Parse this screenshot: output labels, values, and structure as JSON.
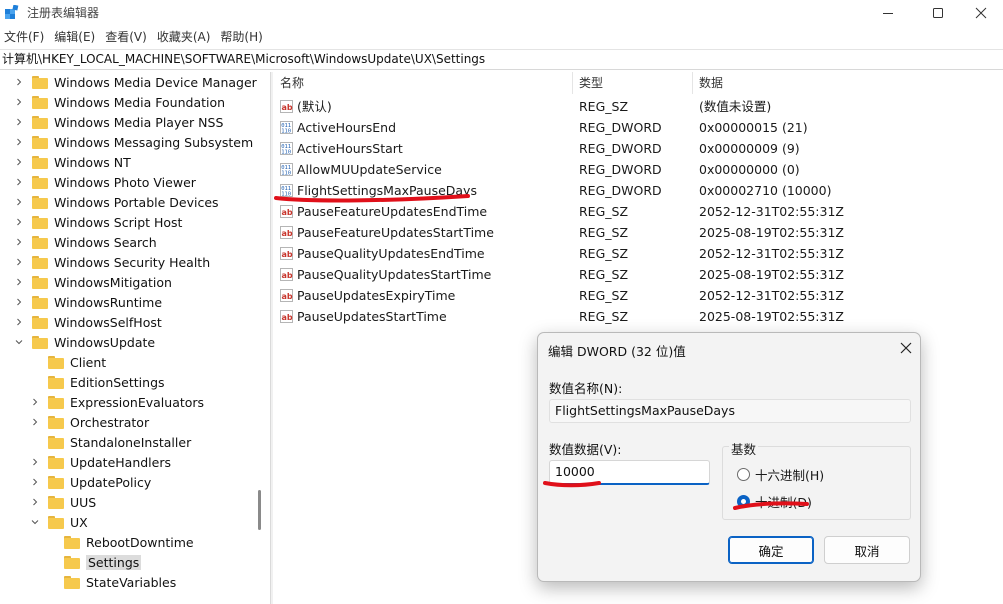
{
  "window": {
    "title": "注册表编辑器"
  },
  "menu": [
    "文件(F)",
    "编辑(E)",
    "查看(V)",
    "收藏夹(A)",
    "帮助(H)"
  ],
  "address": "计算机\\HKEY_LOCAL_MACHINE\\SOFTWARE\\Microsoft\\WindowsUpdate\\UX\\Settings",
  "tree": [
    {
      "label": "Windows Media Device Manager",
      "level": 0,
      "expander": "collapsed"
    },
    {
      "label": "Windows Media Foundation",
      "level": 0,
      "expander": "collapsed"
    },
    {
      "label": "Windows Media Player NSS",
      "level": 0,
      "expander": "collapsed"
    },
    {
      "label": "Windows Messaging Subsystem",
      "level": 0,
      "expander": "collapsed"
    },
    {
      "label": "Windows NT",
      "level": 0,
      "expander": "collapsed"
    },
    {
      "label": "Windows Photo Viewer",
      "level": 0,
      "expander": "collapsed"
    },
    {
      "label": "Windows Portable Devices",
      "level": 0,
      "expander": "collapsed"
    },
    {
      "label": "Windows Script Host",
      "level": 0,
      "expander": "collapsed"
    },
    {
      "label": "Windows Search",
      "level": 0,
      "expander": "collapsed"
    },
    {
      "label": "Windows Security Health",
      "level": 0,
      "expander": "collapsed"
    },
    {
      "label": "WindowsMitigation",
      "level": 0,
      "expander": "collapsed"
    },
    {
      "label": "WindowsRuntime",
      "level": 0,
      "expander": "collapsed"
    },
    {
      "label": "WindowsSelfHost",
      "level": 0,
      "expander": "collapsed"
    },
    {
      "label": "WindowsUpdate",
      "level": 0,
      "expander": "expanded"
    },
    {
      "label": "Client",
      "level": 1,
      "expander": "none"
    },
    {
      "label": "EditionSettings",
      "level": 1,
      "expander": "none"
    },
    {
      "label": "ExpressionEvaluators",
      "level": 1,
      "expander": "collapsed"
    },
    {
      "label": "Orchestrator",
      "level": 1,
      "expander": "collapsed"
    },
    {
      "label": "StandaloneInstaller",
      "level": 1,
      "expander": "none"
    },
    {
      "label": "UpdateHandlers",
      "level": 1,
      "expander": "collapsed"
    },
    {
      "label": "UpdatePolicy",
      "level": 1,
      "expander": "collapsed"
    },
    {
      "label": "UUS",
      "level": 1,
      "expander": "collapsed"
    },
    {
      "label": "UX",
      "level": 1,
      "expander": "expanded"
    },
    {
      "label": "RebootDowntime",
      "level": 2,
      "expander": "none"
    },
    {
      "label": "Settings",
      "level": 2,
      "expander": "none",
      "selected": true
    },
    {
      "label": "StateVariables",
      "level": 2,
      "expander": "none"
    }
  ],
  "list": {
    "columns": [
      "名称",
      "类型",
      "数据"
    ],
    "rows": [
      {
        "icon": "string-value-icon",
        "name": "(默认)",
        "type": "REG_SZ",
        "data": "(数值未设置)"
      },
      {
        "icon": "binary-value-icon",
        "name": "ActiveHoursEnd",
        "type": "REG_DWORD",
        "data": "0x00000015 (21)"
      },
      {
        "icon": "binary-value-icon",
        "name": "ActiveHoursStart",
        "type": "REG_DWORD",
        "data": "0x00000009 (9)"
      },
      {
        "icon": "binary-value-icon",
        "name": "AllowMUUpdateService",
        "type": "REG_DWORD",
        "data": "0x00000000 (0)"
      },
      {
        "icon": "binary-value-icon",
        "name": "FlightSettingsMaxPauseDays",
        "type": "REG_DWORD",
        "data": "0x00002710 (10000)"
      },
      {
        "icon": "string-value-icon",
        "name": "PauseFeatureUpdatesEndTime",
        "type": "REG_SZ",
        "data": "2052-12-31T02:55:31Z"
      },
      {
        "icon": "string-value-icon",
        "name": "PauseFeatureUpdatesStartTime",
        "type": "REG_SZ",
        "data": "2025-08-19T02:55:31Z"
      },
      {
        "icon": "string-value-icon",
        "name": "PauseQualityUpdatesEndTime",
        "type": "REG_SZ",
        "data": "2052-12-31T02:55:31Z"
      },
      {
        "icon": "string-value-icon",
        "name": "PauseQualityUpdatesStartTime",
        "type": "REG_SZ",
        "data": "2025-08-19T02:55:31Z"
      },
      {
        "icon": "string-value-icon",
        "name": "PauseUpdatesExpiryTime",
        "type": "REG_SZ",
        "data": "2052-12-31T02:55:31Z"
      },
      {
        "icon": "string-value-icon",
        "name": "PauseUpdatesStartTime",
        "type": "REG_SZ",
        "data": "2025-08-19T02:55:31Z"
      }
    ]
  },
  "dialog": {
    "title": "编辑 DWORD (32 位)值",
    "name_label": "数值名称(N):",
    "name_value": "FlightSettingsMaxPauseDays",
    "data_label": "数值数据(V):",
    "data_value": "10000",
    "base_label": "基数",
    "hex_label": "十六进制(H)",
    "dec_label": "十进制(D)",
    "selected_base": "decimal",
    "ok_label": "确定",
    "cancel_label": "取消"
  },
  "colors": {
    "accent": "#0a62c4",
    "annotation_red": "#e0101a",
    "folder": "#f6c94d"
  }
}
